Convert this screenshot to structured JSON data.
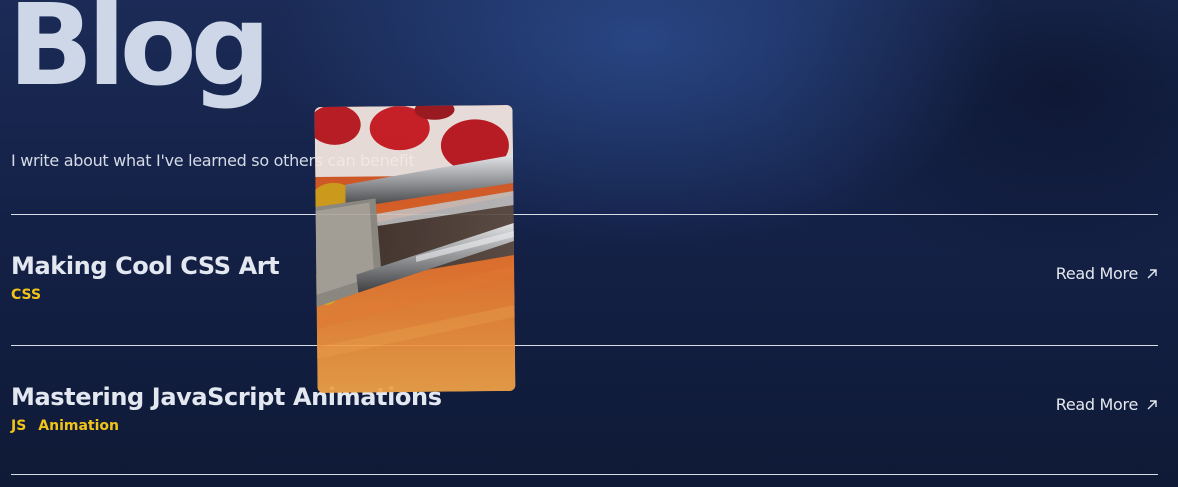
{
  "header": {
    "title": "Blog",
    "subtitle": "I write about what I've learned so others can benefit"
  },
  "posts": [
    {
      "title": "Making Cool CSS Art",
      "tags": [
        "CSS"
      ],
      "cta": "Read More"
    },
    {
      "title": "Mastering JavaScript Animations",
      "tags": [
        "JS",
        "Animation"
      ],
      "cta": "Read More"
    }
  ],
  "preview": {
    "icon": "paintbrush-photo"
  },
  "colors": {
    "accent": "#f0c419",
    "text": "#e2e7f0",
    "background": "#142147"
  }
}
